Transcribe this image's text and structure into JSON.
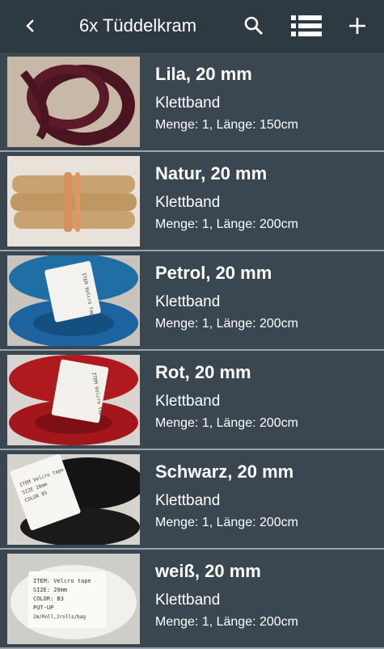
{
  "header": {
    "title": "6x Tüddelkram",
    "icons": [
      "back-chevron-icon",
      "search-icon",
      "list-view-icon",
      "add-icon"
    ]
  },
  "items": [
    {
      "name": "Lila, 20 mm",
      "category": "Klettband",
      "details": "Menge: 1, Länge: 150cm",
      "color": "#4a1420",
      "label": ""
    },
    {
      "name": "Natur,  20 mm",
      "category": "Klettband",
      "details": "Menge: 1, Länge: 200cm",
      "color": "#c9a36f",
      "label": ""
    },
    {
      "name": "Petrol,  20 mm",
      "category": "Klettband",
      "details": "Menge: 1, Länge: 200cm",
      "color": "#1f6fa5",
      "label": "ITEM Velcro tape\nSIZE 20mm\nCOLOR 084\nPUT-UP 2m/roll"
    },
    {
      "name": "Rot,  20 mm",
      "category": "Klettband",
      "details": "Menge: 1, Länge: 200cm",
      "color": "#b01a1f",
      "label": "ITEM Velcro tape\nSIZE 20mm\nCOLOR 084\n2rolls/bag"
    },
    {
      "name": "Schwarz, 20 mm",
      "category": "Klettband",
      "details": "Menge: 1, Länge: 200cm",
      "color": "#141414",
      "label": "ITEM Velcro tape\nSIZE 20mm\nCOLOR 85\n2m/roll,2rolls/bag"
    },
    {
      "name": "weiß, 20 mm",
      "category": "Klettband",
      "details": "Menge: 1, Länge: 200cm",
      "color": "#ecebe6",
      "label": "ITEM: Velcro tape\nSIZE: 20mm\nCOLOR: B3\nPUT-UP\n2m/Roll,2rolls/bag"
    }
  ]
}
